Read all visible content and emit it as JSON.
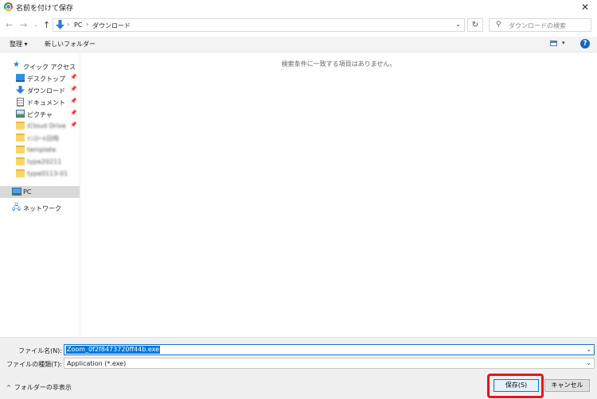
{
  "window": {
    "title": "名前を付けて保存"
  },
  "address": {
    "crumbs": [
      "PC",
      "ダウンロード"
    ],
    "separator": "›"
  },
  "search": {
    "placeholder": "ダウンロードの検索"
  },
  "toolbar": {
    "organize": "整理 ▾",
    "new_folder": "新しいフォルダー"
  },
  "sidebar": {
    "quick_access": "クイック アクセス",
    "items": [
      {
        "label": "デスクトップ",
        "icon": "desktop-icon",
        "pinned": true
      },
      {
        "label": "ダウンロード",
        "icon": "download-arrow-icon",
        "pinned": true
      },
      {
        "label": "ドキュメント",
        "icon": "document-icon",
        "pinned": true
      },
      {
        "label": "ピクチャ",
        "icon": "pictures-icon",
        "pinned": true
      },
      {
        "label": "iCloud Drive",
        "icon": "folder-icon",
        "pinned": true,
        "blurred": true
      },
      {
        "label": "ｲﾝｽﾄｰﾙ日時",
        "icon": "folder-icon",
        "blurred": true
      },
      {
        "label": "template",
        "icon": "folder-icon",
        "blurred": true
      },
      {
        "label": "type20211",
        "icon": "folder-icon",
        "blurred": true
      },
      {
        "label": "type0113-01",
        "icon": "folder-icon",
        "blurred": true
      }
    ],
    "pc": "PC",
    "network": "ネットワーク",
    "pin_glyph": "📌"
  },
  "main": {
    "empty_message": "検索条件に一致する項目はありません。"
  },
  "form": {
    "filename_label": "ファイル名(N):",
    "filename_value": "Zoom_0f2f8473720ff44b.exe",
    "filetype_label": "ファイルの種類(T):",
    "filetype_value": "Application (*.exe)",
    "hide_folders": "フォルダーの非表示",
    "save_label": "保存(S)",
    "cancel_label": "キャンセル"
  },
  "colors": {
    "accent": "#0078d7",
    "highlight": "#e8141b",
    "folder": "#f7d66b"
  }
}
